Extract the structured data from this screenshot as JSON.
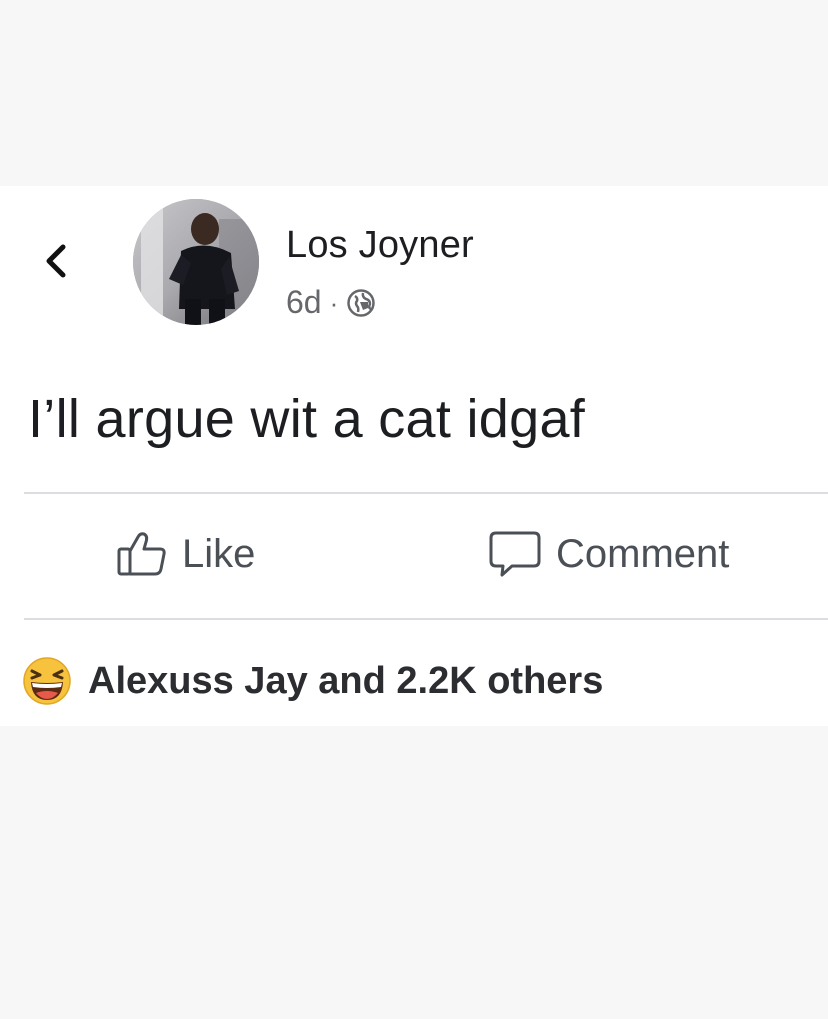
{
  "post": {
    "author_name": "Los Joyner",
    "timestamp": "6d",
    "separator": "·",
    "audience_icon": "globe-icon",
    "text": "I’ll argue wit a cat idgaf"
  },
  "navigation": {
    "back_icon": "chevron-left-icon"
  },
  "actions": {
    "like_label": "Like",
    "like_icon": "thumbs-up-icon",
    "comment_label": "Comment",
    "comment_icon": "speech-bubble-icon"
  },
  "reactions": {
    "icon": "haha-emoji-icon",
    "summary": "Alexuss Jay and 2.2K others"
  },
  "colors": {
    "page_background": "#f7f7f8",
    "card_background": "#ffffff",
    "primary_text": "#1c1e21",
    "secondary_text": "#65676b",
    "action_text": "#4b4f56",
    "divider": "#dcdde0",
    "emoji_yellow": "#f7c23e"
  }
}
